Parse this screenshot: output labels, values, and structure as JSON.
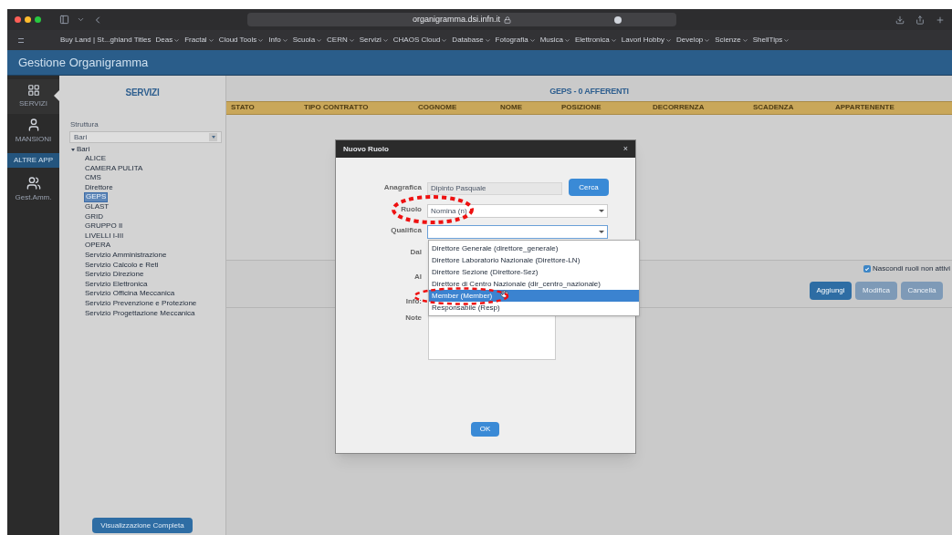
{
  "browser": {
    "address": "organigramma.dsi.infn.it",
    "bookmarks": [
      {
        "label": "Buy Land | St...ghland Titles",
        "has_menu": false
      },
      {
        "label": "Deas",
        "has_menu": true
      },
      {
        "label": "Fractal",
        "has_menu": true
      },
      {
        "label": "Cloud Tools",
        "has_menu": true
      },
      {
        "label": "Info",
        "has_menu": true
      },
      {
        "label": "Scuola",
        "has_menu": true
      },
      {
        "label": "CERN",
        "has_menu": true
      },
      {
        "label": "Servizi",
        "has_menu": true
      },
      {
        "label": "CHAOS Cloud",
        "has_menu": true
      },
      {
        "label": "Database",
        "has_menu": true
      },
      {
        "label": "Fotografia",
        "has_menu": true
      },
      {
        "label": "Musica",
        "has_menu": true
      },
      {
        "label": "Elettronica",
        "has_menu": true
      },
      {
        "label": "Lavori Hobby",
        "has_menu": true
      },
      {
        "label": "Develop",
        "has_menu": true
      },
      {
        "label": "Scienze",
        "has_menu": true
      },
      {
        "label": "ShellTips",
        "has_menu": true
      }
    ]
  },
  "app": {
    "title": "Gestione Organigramma"
  },
  "nav": [
    {
      "kind": "icon",
      "label": "SERVIZI",
      "selected": true
    },
    {
      "kind": "icon",
      "label": "MANSIONI",
      "selected": false
    },
    {
      "kind": "header",
      "label": "ALTRE APP",
      "selected": false
    },
    {
      "kind": "icon",
      "label": "Gest.Amm.",
      "selected": false
    }
  ],
  "servizi": {
    "title": "SERVIZI",
    "structure_label": "Struttura",
    "structure_value": "Bari",
    "tree": [
      {
        "label": "Bari",
        "expanded": true,
        "selected": false,
        "children": [
          {
            "label": "ALICE",
            "selected": false
          },
          {
            "label": "CAMERA PULITA",
            "selected": false
          },
          {
            "label": "CMS",
            "selected": false
          },
          {
            "label": "Direttore",
            "selected": false
          },
          {
            "label": "GEPS",
            "selected": true
          },
          {
            "label": "GLAST",
            "selected": false
          },
          {
            "label": "GRID",
            "selected": false
          },
          {
            "label": "GRUPPO II",
            "selected": false
          },
          {
            "label": "LIVELLI I-III",
            "selected": false
          },
          {
            "label": "OPERA",
            "selected": false
          },
          {
            "label": "Servizio Amministrazione",
            "selected": false
          },
          {
            "label": "Servizio Calcolo e Reti",
            "selected": false
          },
          {
            "label": "Servizio Direzione",
            "selected": false
          },
          {
            "label": "Servizio Elettronica",
            "selected": false
          },
          {
            "label": "Servizio Officina Meccanica",
            "selected": false
          },
          {
            "label": "Servizio Prevenzione e Protezione",
            "selected": false
          },
          {
            "label": "Servizio Progettazione Meccanica",
            "selected": false
          }
        ]
      }
    ],
    "full_view_button": "Visualizzazione Completa"
  },
  "table": {
    "title": "GEPS - 0 AFFERENTI",
    "columns": [
      "STATO",
      "TIPO CONTRATTO",
      "COGNOME",
      "NOME",
      "POSIZIONE",
      "DECORRENZA",
      "SCADENZA",
      "APPARTENENTE"
    ]
  },
  "hide_inactive": {
    "label": "Nascondi ruoli non attivi",
    "checked": true
  },
  "actions": [
    {
      "label": "Aggiungi",
      "disabled": false
    },
    {
      "label": "Modifica",
      "disabled": true
    },
    {
      "label": "Cancella",
      "disabled": true
    }
  ],
  "dialog": {
    "title": "Nuovo Ruolo",
    "close": "×",
    "anagrafica": {
      "label": "Anagrafica",
      "value": "Dipinto Pasquale",
      "button": "Cerca"
    },
    "ruolo": {
      "label": "Ruolo",
      "value": "Nomina (n)"
    },
    "qualifica": {
      "label": "Qualifica",
      "expanded": true,
      "options": [
        {
          "label": "Direttore Generale (direttore_generale)",
          "selected": false
        },
        {
          "label": "Direttore Laboratorio Nazionale (Direttore-LN)",
          "selected": false
        },
        {
          "label": "Direttore Sezione (Direttore-Sez)",
          "selected": false
        },
        {
          "label": "Direttore di Centro Nazionale (dir_centro_nazionale)",
          "selected": false
        },
        {
          "label": "Member (Member)",
          "selected": true
        },
        {
          "label": "Responsabile (Resp)",
          "selected": false
        }
      ]
    },
    "dal_label": "Dal",
    "al_label": "Al",
    "info_label": "Info:",
    "note_label": "Note",
    "ok": "OK"
  }
}
